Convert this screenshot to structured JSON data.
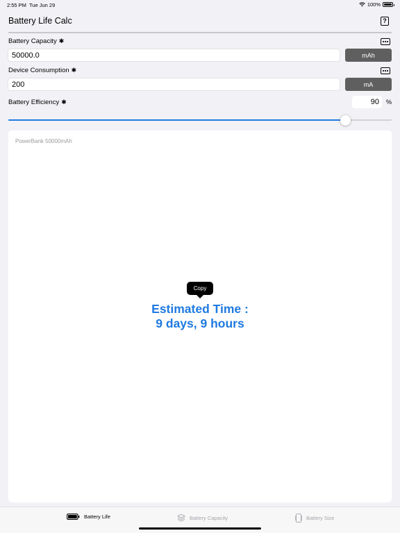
{
  "status": {
    "time": "2:55 PM",
    "date": "Tue Jun 29",
    "battery": "100%"
  },
  "nav": {
    "title": "Battery Life Calc",
    "help_icon": "question-mark-icon"
  },
  "capacity": {
    "label": "Battery Capacity",
    "required_mark": "✱",
    "value": "50000.0",
    "unit": "mAh"
  },
  "consumption": {
    "label": "Device Consumption",
    "required_mark": "✱",
    "value": "200",
    "unit": "mA"
  },
  "efficiency": {
    "label": "Battery Efficiency",
    "required_mark": "✱",
    "value": "90",
    "unit": "%",
    "slider_fraction": 0.88
  },
  "result": {
    "caption": "PowerBank 50000mAh",
    "copy_label": "Copy",
    "text": "Estimated Time :\n9 days, 9 hours"
  },
  "tabs": [
    {
      "label": "Battery Life",
      "icon": "battery-icon",
      "active": true
    },
    {
      "label": "Battery Capacity",
      "icon": "layers-icon",
      "active": false
    },
    {
      "label": "Battery Size",
      "icon": "phone-size-icon",
      "active": false
    }
  ],
  "colors": {
    "accent": "#1f7ae0",
    "unit_button": "#5f5f5f"
  }
}
